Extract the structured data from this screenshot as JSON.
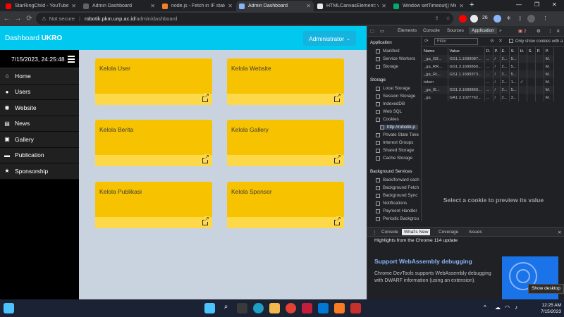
{
  "browser": {
    "tabs": [
      {
        "label": "StarRingChild - YouTube",
        "active": false
      },
      {
        "label": "Admin Dashboard",
        "active": false
      },
      {
        "label": "node.js - Fetch in IF stateme",
        "active": false
      },
      {
        "label": "Admin Dashboard",
        "active": true
      },
      {
        "label": "HTMLCanvasElement: width",
        "active": false
      },
      {
        "label": "Window setTimeout() Meth",
        "active": false
      }
    ],
    "security_label": "Not secure",
    "url_host": "robotik.pkm.unp.ac.id",
    "url_path": "/admin/dashboard",
    "extension_count": "26"
  },
  "app": {
    "brand_prefix": "Dashboard ",
    "brand_bold": "UKRO",
    "user_menu_label": "Administrator",
    "clock": "7/15/2023, 24:25:48",
    "nav": [
      {
        "label": "Home",
        "icon": "home-icon",
        "glyph": "⌂"
      },
      {
        "label": "Users",
        "icon": "user-icon",
        "glyph": "●"
      },
      {
        "label": "Website",
        "icon": "globe-icon",
        "glyph": "◉"
      },
      {
        "label": "News",
        "icon": "newspaper-icon",
        "glyph": "▤"
      },
      {
        "label": "Gallery",
        "icon": "image-icon",
        "glyph": "▣"
      },
      {
        "label": "Publication",
        "icon": "book-icon",
        "glyph": "▬"
      },
      {
        "label": "Sponsorship",
        "icon": "star-icon",
        "glyph": "★"
      }
    ],
    "cards": [
      {
        "title": "Kelola User"
      },
      {
        "title": "Kelola Website"
      },
      {
        "title": "Kelola Berita"
      },
      {
        "title": "Kelola Gallery"
      },
      {
        "title": "Kelola Publikasi"
      },
      {
        "title": "Kelola Sponsor"
      }
    ],
    "colors": {
      "topbar": "#00c8ef",
      "card": "#f7c200",
      "sidebar": "#000000"
    }
  },
  "devtools": {
    "tabs": [
      "Elements",
      "Console",
      "Sources",
      "Application"
    ],
    "active_tab": "Application",
    "issues_badge": "2",
    "sections": {
      "application": {
        "title": "Application",
        "items": [
          "Manifest",
          "Service Workers",
          "Storage"
        ]
      },
      "storage": {
        "title": "Storage",
        "items": [
          "Local Storage",
          "Session Storage",
          "IndexedDB",
          "Web SQL",
          "Cookies",
          "http://robotik.p",
          "Private State Toke",
          "Interest Groups",
          "Shared Storage",
          "Cache Storage"
        ]
      },
      "background": {
        "title": "Background Services",
        "items": [
          "Back/forward cach",
          "Background Fetch",
          "Background Sync",
          "Notifications",
          "Payment Handler",
          "Periodic Backgrou"
        ]
      }
    },
    "filter_placeholder": "Filter",
    "only_show_label": "Only show cookies with a",
    "cookie_columns": [
      "Name",
      "Value",
      "D.",
      "P.",
      "E.",
      "S.",
      "H.",
      "S.",
      "P.",
      "P."
    ],
    "cookies": [
      [
        "_ga_G9...",
        "GS1.1.1689087...",
        "...",
        "/",
        "2...",
        "5...",
        "",
        "",
        "",
        "M."
      ],
      [
        "_ga_RR...",
        "GS1.3.1689860...",
        "...",
        "/",
        "2...",
        "5...",
        "",
        "",
        "",
        "M."
      ],
      [
        "_ga_RL...",
        "GS1.1.1689373...",
        "...",
        "/",
        "2...",
        "5...",
        "",
        "",
        "",
        "M."
      ],
      [
        "token",
        "",
        "...",
        "/",
        "2...",
        "1...",
        "✓",
        "",
        "",
        "M."
      ],
      [
        "_ga_I6...",
        "GS1.3.1689860...",
        "...",
        "/",
        "2...",
        "5...",
        "",
        "",
        "",
        "M."
      ],
      [
        "_ga",
        "GA1.3.1027762...",
        "...",
        "/",
        "2...",
        "3...",
        "",
        "",
        "",
        "M."
      ]
    ],
    "preview_text": "Select a cookie to preview its value",
    "drawer_tabs": [
      "Console",
      "What's New",
      "Coverage",
      "Issues"
    ],
    "drawer_active": "What's New",
    "highlights": "Highlights from the Chrome 114 update",
    "whatsnew_title": "Support WebAssembly debugging",
    "whatsnew_body": "Chrome DevTools supports WebAssembly debugging with DWARF information (using an extension)."
  },
  "tooltip": "Show desktop",
  "taskbar": {
    "time": "12:25 AM",
    "date": "7/15/2023"
  }
}
